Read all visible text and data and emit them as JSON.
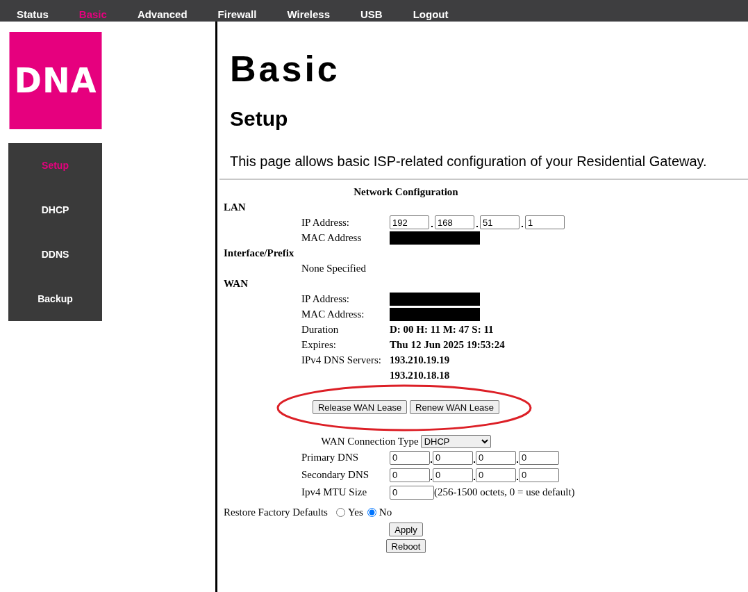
{
  "nav": [
    {
      "label": "Status",
      "selected": false
    },
    {
      "label": "Basic",
      "selected": true
    },
    {
      "label": "Advanced",
      "selected": false
    },
    {
      "label": "Firewall",
      "selected": false
    },
    {
      "label": "Wireless",
      "selected": false
    },
    {
      "label": "USB",
      "selected": false
    },
    {
      "label": "Logout",
      "selected": false
    }
  ],
  "logo": {
    "text": "DNA"
  },
  "sidebar": {
    "items": [
      {
        "label": "Setup",
        "selected": true
      },
      {
        "label": "DHCP",
        "selected": false
      },
      {
        "label": "DDNS",
        "selected": false
      },
      {
        "label": "Backup",
        "selected": false
      }
    ]
  },
  "page": {
    "title": "Basic",
    "subtitle": "Setup",
    "description": "This page allows basic ISP-related configuration of your Residential Gateway."
  },
  "network_config": {
    "title": "Network Configuration",
    "sections": [
      {
        "heading": "LAN",
        "rows": [
          {
            "kind": "ip",
            "label": "IP Address:",
            "octets": [
              "192",
              "168",
              "51",
              "1"
            ]
          },
          {
            "kind": "redacted",
            "label": "MAC Address"
          }
        ]
      },
      {
        "heading": "Interface/Prefix",
        "rows": [
          {
            "kind": "note",
            "label": "None Specified"
          }
        ]
      },
      {
        "heading": "WAN",
        "rows": [
          {
            "kind": "redacted",
            "label": "IP Address:"
          },
          {
            "kind": "redacted",
            "label": "MAC Address:"
          },
          {
            "kind": "value",
            "label": "Duration",
            "value": "D: 00 H: 11 M: 47 S: 11"
          },
          {
            "kind": "value",
            "label": "Expires:",
            "value": "Thu 12 Jun 2025 19:53:24"
          },
          {
            "kind": "value",
            "label": "IPv4 DNS Servers:",
            "value": "193.210.19.19"
          },
          {
            "kind": "value",
            "value": "193.210.18.18"
          }
        ]
      }
    ]
  },
  "lease": {
    "circled": true,
    "buttons": [
      "Release WAN Lease",
      "Renew WAN Lease"
    ]
  },
  "wan_settings": {
    "connection_type": {
      "label": "WAN Connection Type",
      "value": "DHCP"
    },
    "rows": [
      {
        "kind": "ip",
        "label": "Primary DNS",
        "octets": [
          "0",
          "0",
          "0",
          "0"
        ]
      },
      {
        "kind": "ip",
        "label": "Secondary DNS",
        "octets": [
          "0",
          "0",
          "0",
          "0"
        ]
      },
      {
        "kind": "mtu",
        "label": "Ipv4 MTU Size",
        "value": "0",
        "hint": "(256-1500 octets, 0 = use default)"
      }
    ]
  },
  "restore_defaults": {
    "label": "Restore Factory Defaults",
    "options": [
      {
        "label": "Yes",
        "selected": false
      },
      {
        "label": "No",
        "selected": true
      }
    ]
  },
  "buttons": [
    "Apply",
    "Reboot"
  ]
}
